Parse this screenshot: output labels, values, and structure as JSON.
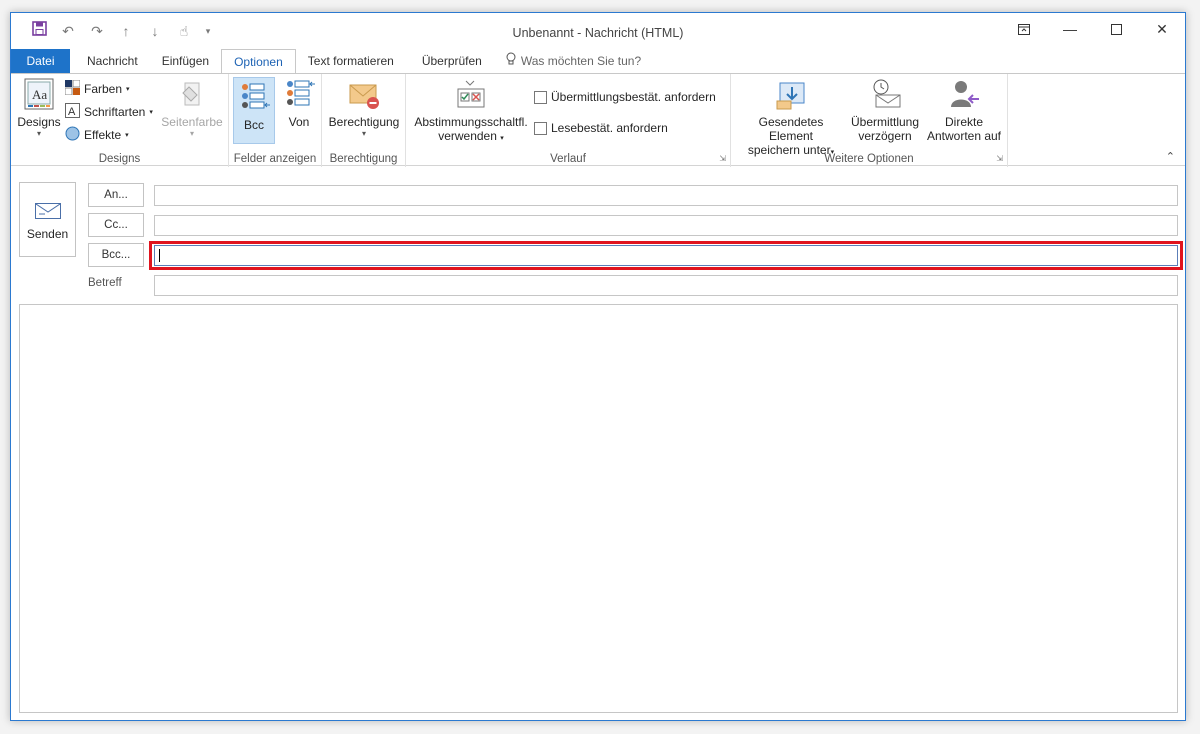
{
  "window": {
    "title": "Unbenannt - Nachricht (HTML)"
  },
  "tabs": [
    {
      "label": "Datei"
    },
    {
      "label": "Nachricht"
    },
    {
      "label": "Einfügen"
    },
    {
      "label": "Optionen"
    },
    {
      "label": "Text formatieren"
    },
    {
      "label": "Überprüfen"
    }
  ],
  "tellme": {
    "label": "Was möchten Sie tun?"
  },
  "ribbon": {
    "designs": {
      "designs_label": "Designs",
      "farben_label": "Farben",
      "schriftarten_label": "Schriftarten",
      "effekte_label": "Effekte",
      "seitenfarbe_label": "Seitenfarbe",
      "group_label": "Designs"
    },
    "felder": {
      "bcc_label": "Bcc",
      "von_label": "Von",
      "group_label": "Felder anzeigen"
    },
    "berechtigung": {
      "berechtigung_label": "Berechtigung",
      "group_label": "Berechtigung"
    },
    "verlauf": {
      "abstimmung_line1": "Abstimmungsschaltfl.",
      "abstimmung_line2": "verwenden",
      "uebermittlung_label": "Übermittlungsbestät. anfordern",
      "lese_label": "Lesebestät. anfordern",
      "group_label": "Verlauf"
    },
    "weitere": {
      "gesendetes_line1": "Gesendetes Element",
      "gesendetes_line2": "speichern unter",
      "verzoegern_line1": "Übermittlung",
      "verzoegern_line2": "verzögern",
      "direkte_line1": "Direkte",
      "direkte_line2": "Antworten auf",
      "group_label": "Weitere Optionen"
    }
  },
  "compose": {
    "send_label": "Senden",
    "to_label": "An...",
    "cc_label": "Cc...",
    "bcc_label": "Bcc...",
    "subject_label": "Betreff"
  },
  "colors": {
    "accent": "#1e73c9",
    "highlight": "#e0141e",
    "selected_bg": "#cde4f7"
  }
}
